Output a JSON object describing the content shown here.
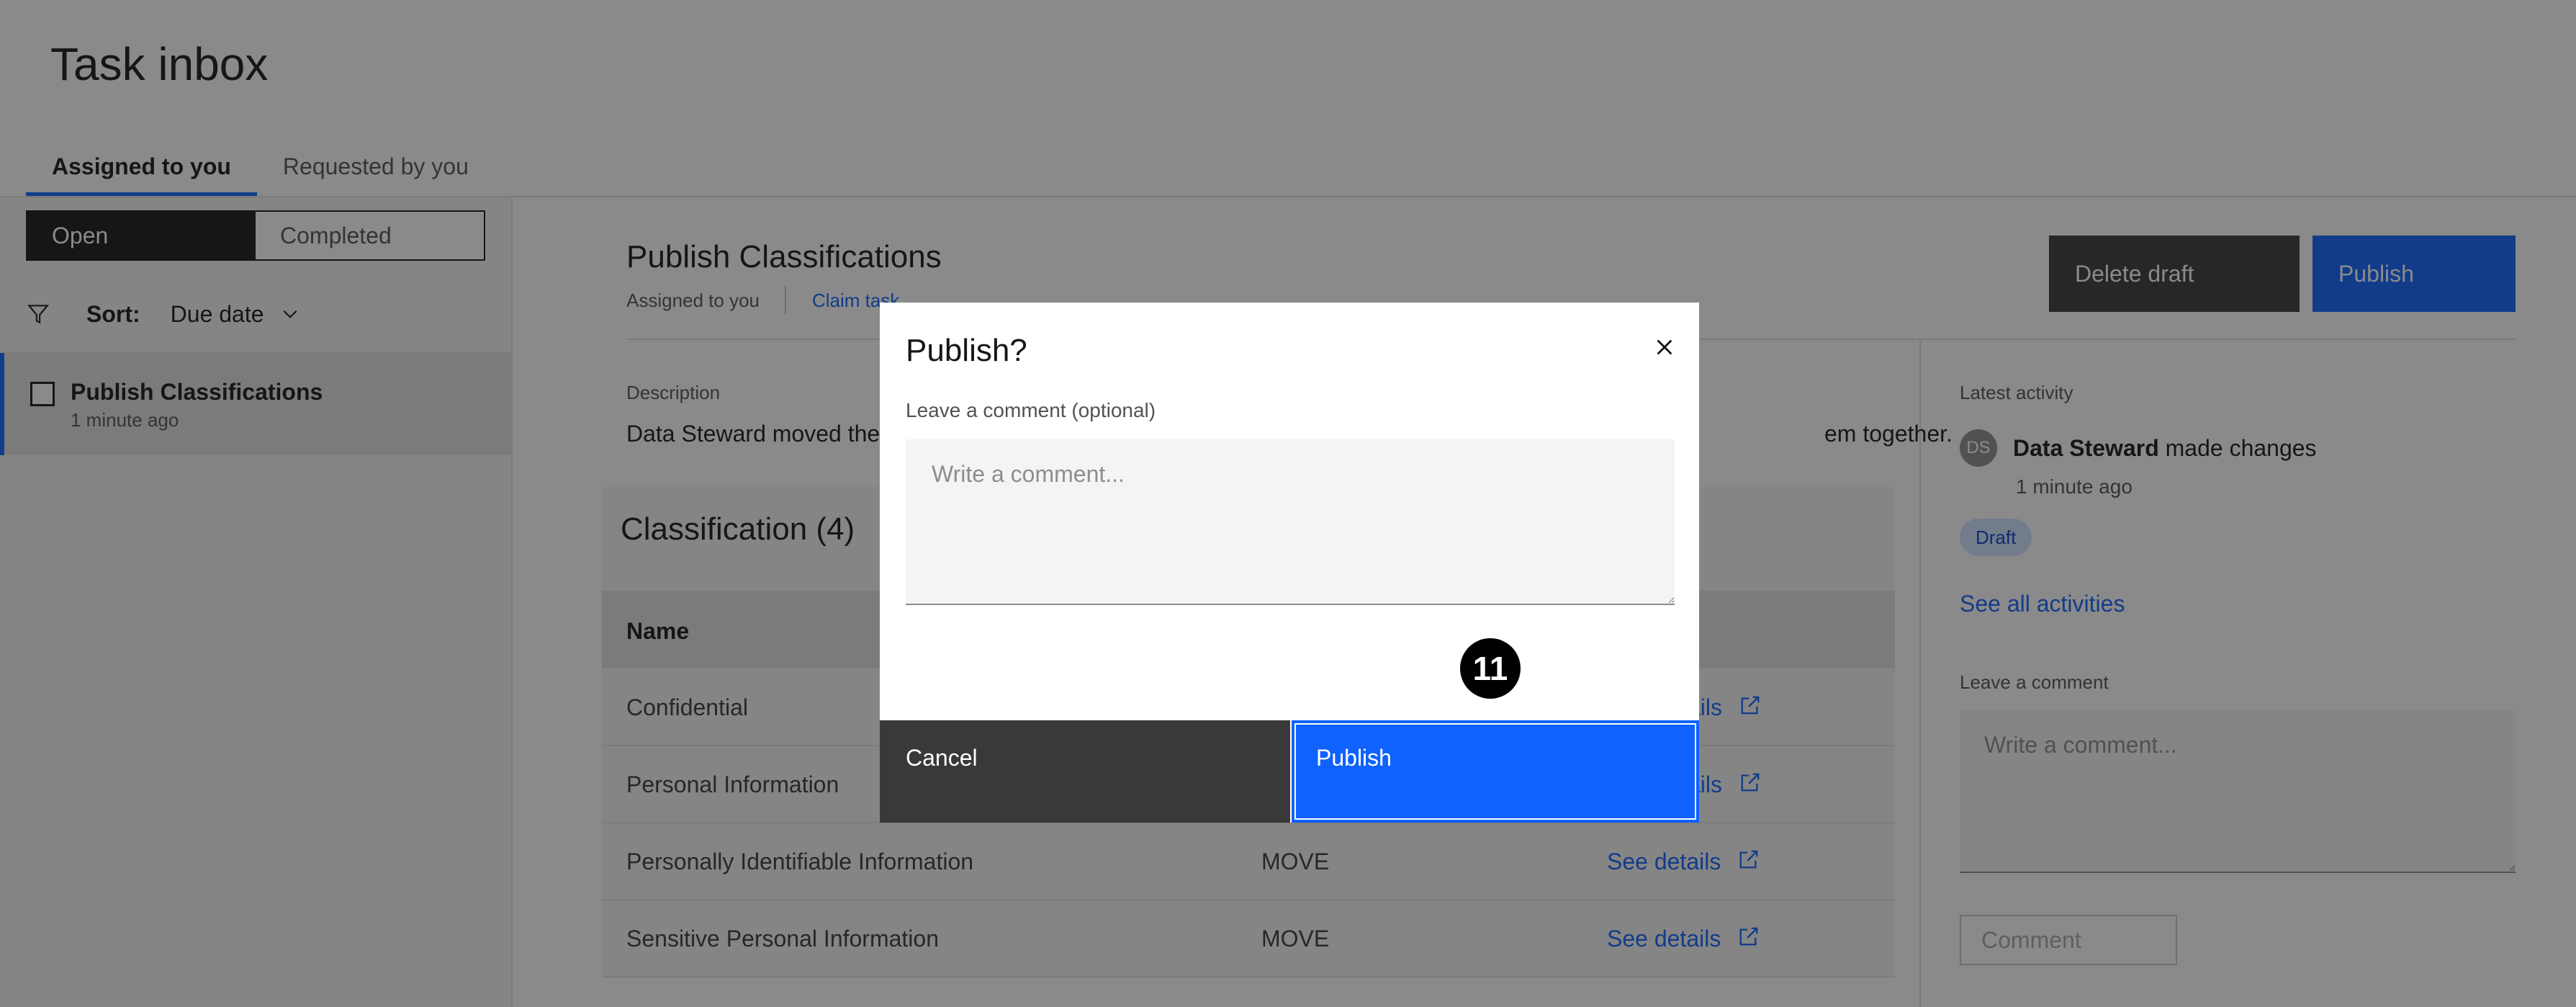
{
  "page": {
    "title": "Task inbox"
  },
  "tabs": [
    {
      "label": "Assigned to you",
      "active": true
    },
    {
      "label": "Requested by you",
      "active": false
    }
  ],
  "left": {
    "segment": {
      "open": "Open",
      "completed": "Completed",
      "selected": "Open"
    },
    "sort": {
      "label": "Sort:",
      "value": "Due date"
    },
    "items": [
      {
        "title": "Publish Classifications",
        "time": "1 minute ago"
      }
    ]
  },
  "main": {
    "title": "Publish Classifications",
    "assigned": "Assigned to you",
    "claim": "Claim task",
    "delete_label": "Delete draft",
    "publish_label": "Publish",
    "description_label": "Description",
    "description_visible_start": "Data Steward moved the",
    "description_visible_end": "em together.",
    "classification": {
      "title": "Classification (4)",
      "header_name": "Name",
      "rows": [
        {
          "name": "Confidential",
          "type": "",
          "link": "See details"
        },
        {
          "name": "Personal Information",
          "type": "",
          "link": "See details"
        },
        {
          "name": "Personally Identifiable Information",
          "type": "MOVE",
          "link": "See details"
        },
        {
          "name": "Sensitive Personal Information",
          "type": "MOVE",
          "link": "See details"
        }
      ],
      "partial_link_text": "ails"
    }
  },
  "activity": {
    "label": "Latest activity",
    "avatar": "DS",
    "actor": "Data Steward",
    "action": " made changes",
    "time": "1 minute ago",
    "tag": "Draft",
    "see_all": "See all activities",
    "comment_label": "Leave a comment",
    "comment_placeholder": "Write a comment...",
    "comment_button": "Comment"
  },
  "modal": {
    "title": "Publish?",
    "comment_label": "Leave a comment (optional)",
    "placeholder": "Write a comment...",
    "cancel": "Cancel",
    "publish": "Publish",
    "step": "11"
  },
  "colors": {
    "primary": "#0f62fe",
    "dark_button": "#393939",
    "overlay": "rgba(22,22,22,0.5)"
  }
}
